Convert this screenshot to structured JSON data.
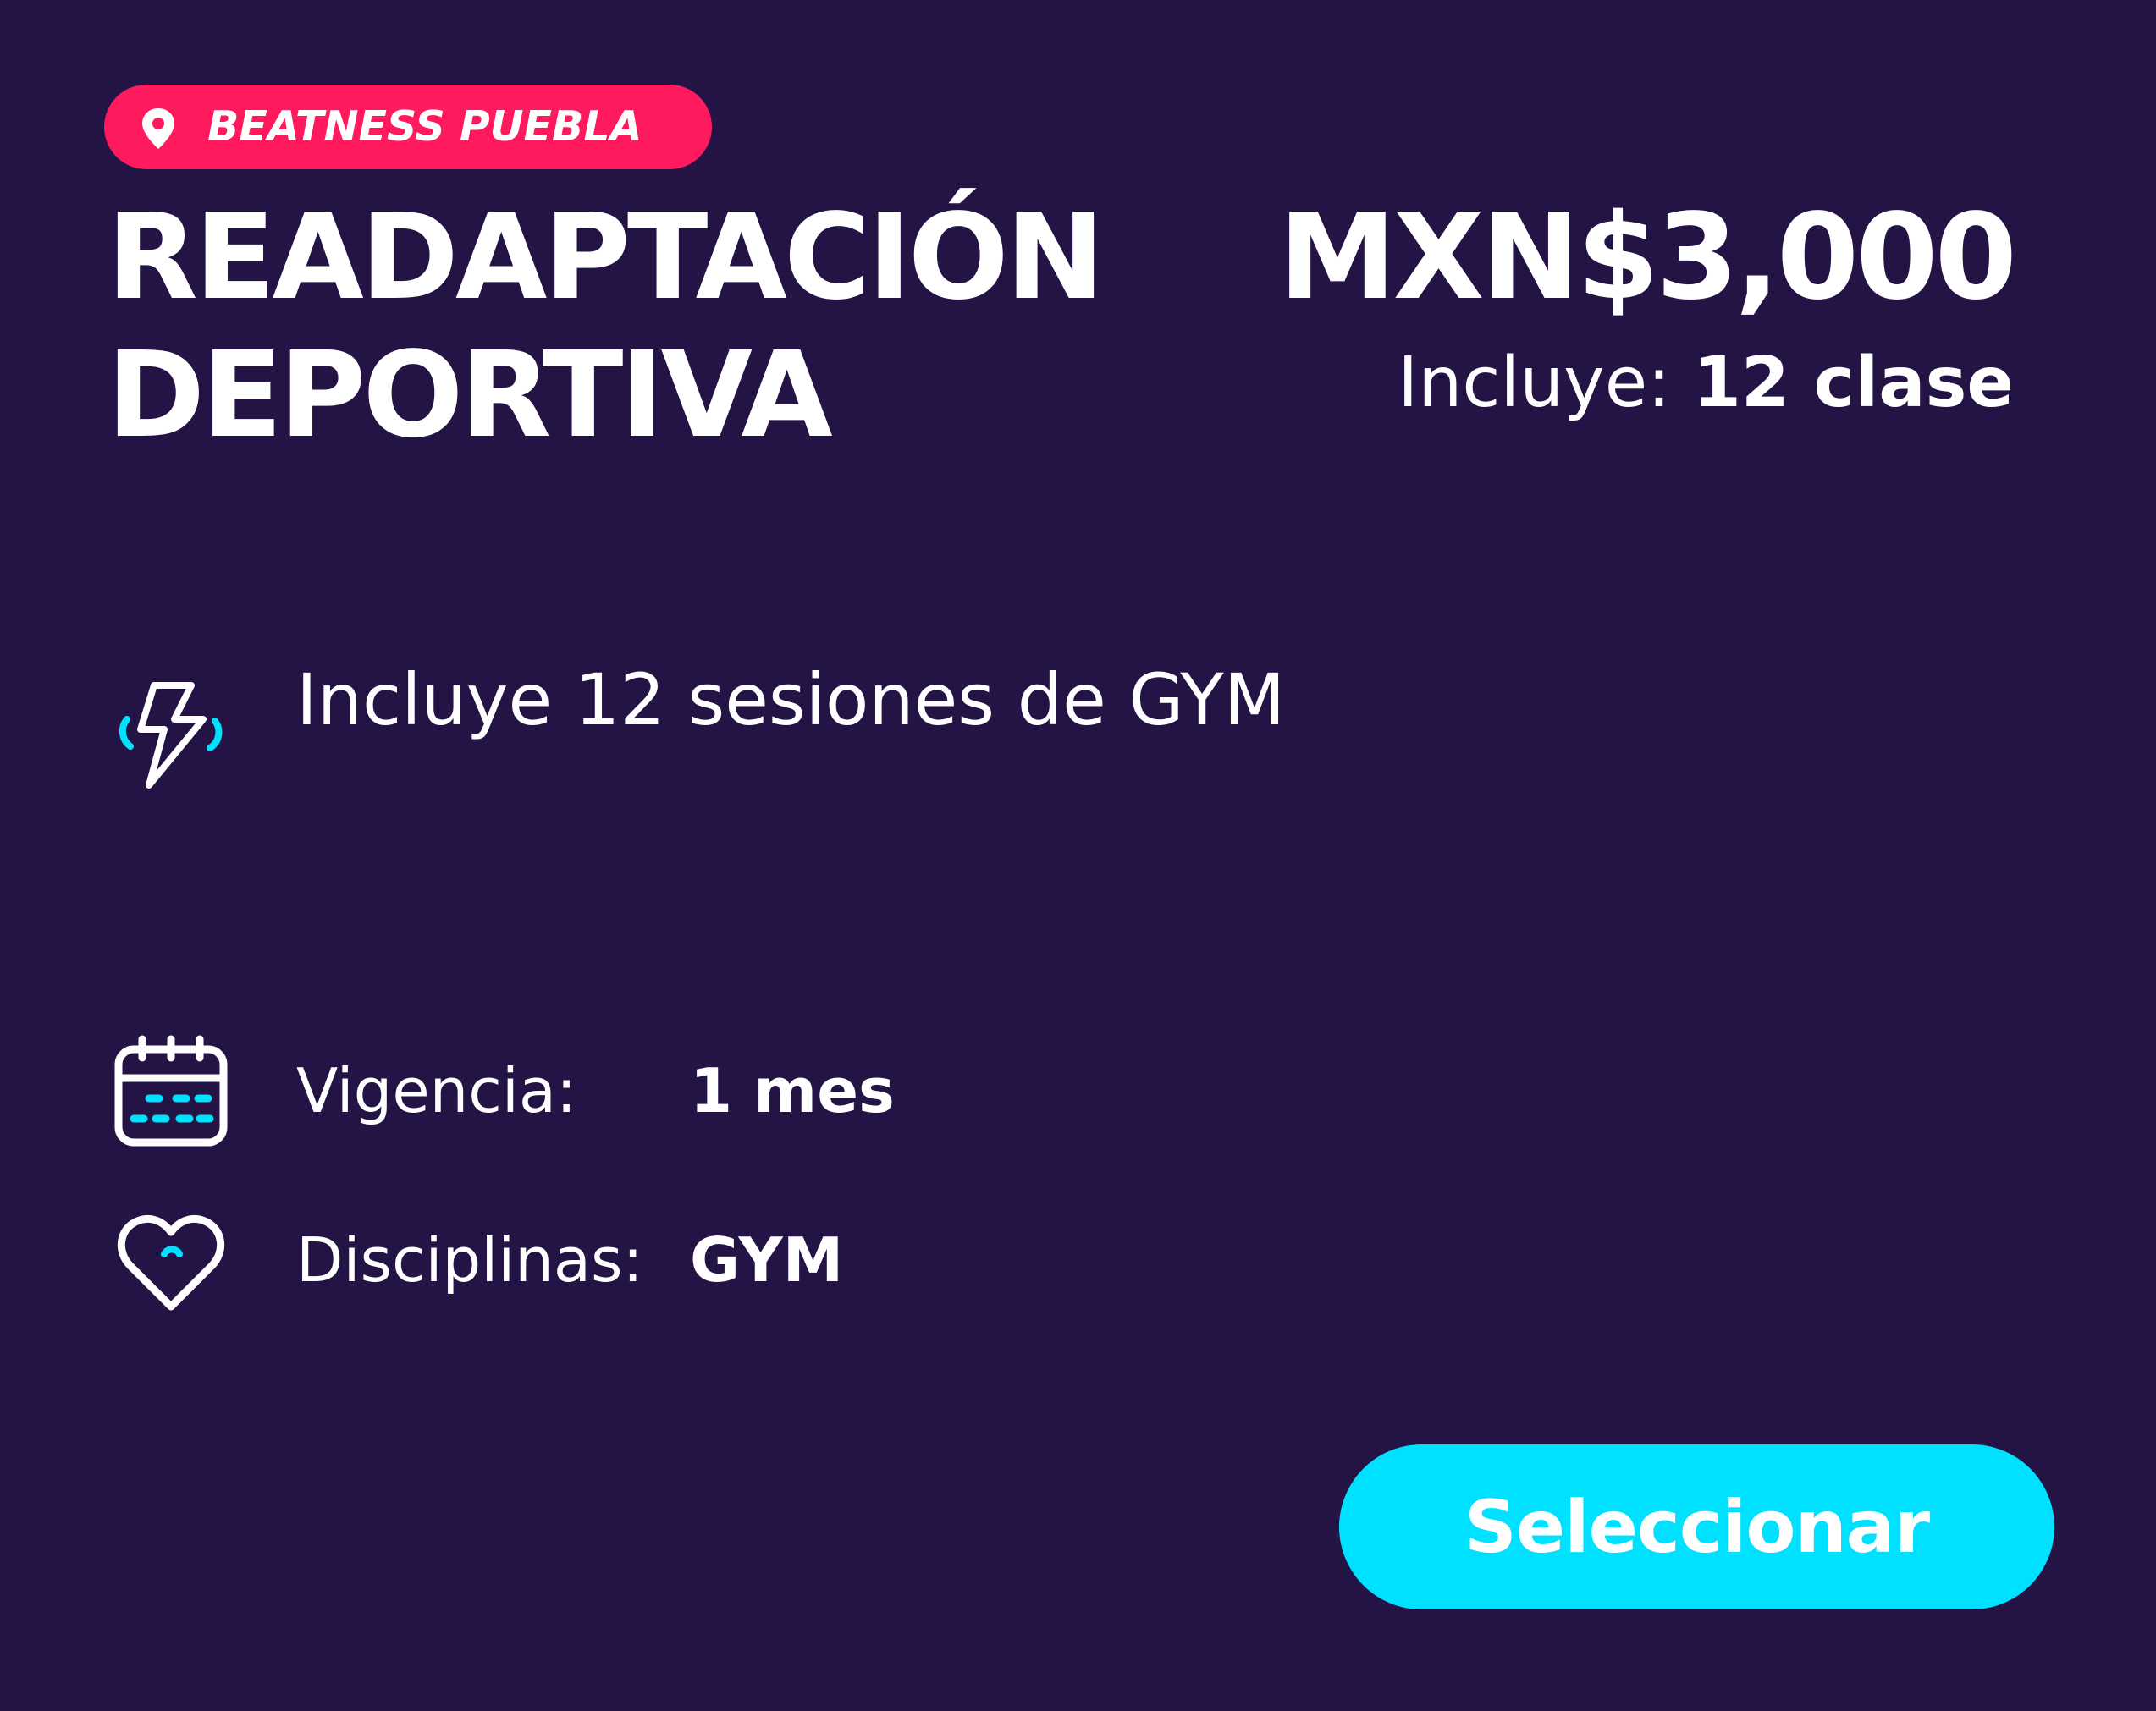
{
  "location": {
    "label": "BEATNESS PUEBLA",
    "icon": "map-pin-icon"
  },
  "plan": {
    "title_line1": "READAPTACIÓN",
    "title_line2": "DEPORTIVA",
    "price": "MXN$3,000",
    "includes_label": "Incluye:",
    "includes_value": "12 clase"
  },
  "feature": {
    "icon": "lightning-bolt-icon",
    "text": "Incluye 12 sesiones de GYM"
  },
  "details": {
    "validity": {
      "icon": "calendar-icon",
      "label": "Vigencia:",
      "value": "1 mes"
    },
    "disciplines": {
      "icon": "heart-icon",
      "label": "Disciplinas:",
      "value": "GYM"
    }
  },
  "action": {
    "select_label": "Seleccionar"
  },
  "colors": {
    "background": "#241446",
    "location_pill": "#ff1a5e",
    "accent": "#00e1ff",
    "text": "#ffffff"
  }
}
